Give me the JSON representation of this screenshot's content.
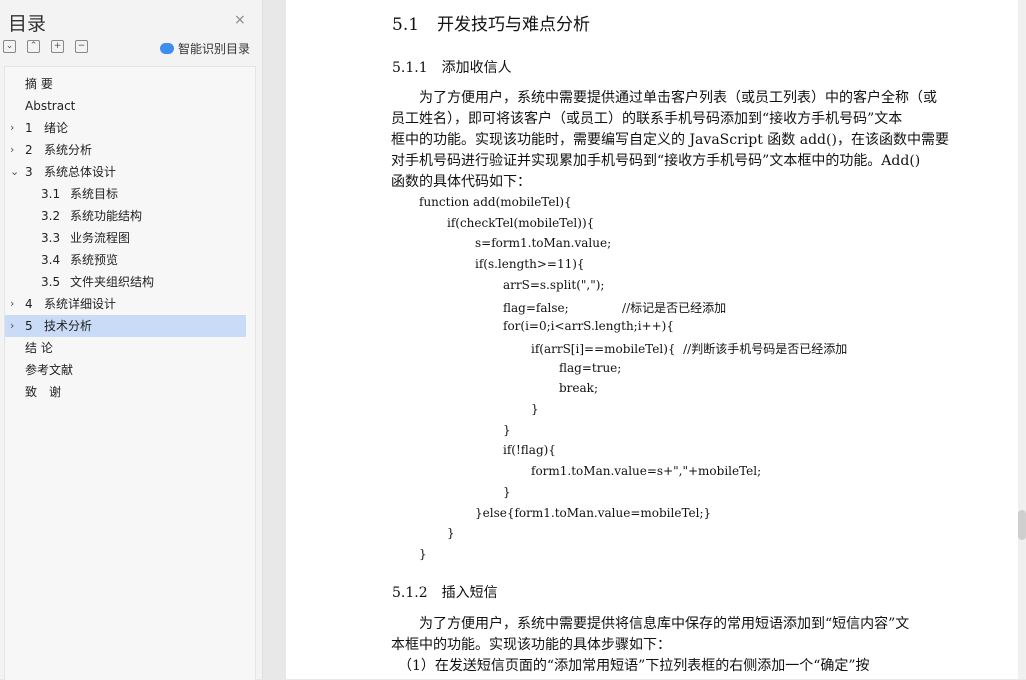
{
  "sidebar": {
    "title": "目录",
    "close_icon": "×",
    "tools": [
      "⌄",
      "⌃",
      "+",
      "−"
    ],
    "smart_label": "智能识别目录",
    "items": [
      {
        "num": "",
        "label": "摘 要",
        "chevron": ""
      },
      {
        "num": "",
        "label": "Abstract",
        "chevron": ""
      },
      {
        "num": "1",
        "label": "绪论",
        "chevron": "›"
      },
      {
        "num": "2",
        "label": "系统分析",
        "chevron": "›"
      },
      {
        "num": "3",
        "label": "系统总体设计",
        "chevron": "⌄"
      },
      {
        "num": "3.1",
        "label": "系统目标",
        "chevron": ""
      },
      {
        "num": "3.2",
        "label": "系统功能结构",
        "chevron": ""
      },
      {
        "num": "3.3",
        "label": "业务流程图",
        "chevron": ""
      },
      {
        "num": "3.4",
        "label": "系统预览",
        "chevron": ""
      },
      {
        "num": "3.5",
        "label": "文件夹组织结构",
        "chevron": ""
      },
      {
        "num": "4",
        "label": "系统详细设计",
        "chevron": "›"
      },
      {
        "num": "5",
        "label": "技术分析",
        "chevron": "›"
      },
      {
        "num": "",
        "label": "结 论",
        "chevron": ""
      },
      {
        "num": "",
        "label": "参考文献",
        "chevron": ""
      },
      {
        "num": "",
        "label": "致　谢",
        "chevron": ""
      }
    ]
  },
  "doc": {
    "h1": {
      "num": "5.1",
      "text": "开发技巧与难点分析"
    },
    "s1": {
      "num": "5.1.1",
      "text": "添加收信人"
    },
    "p1": [
      "　　为了方便用户，系统中需要提供通过单击客户列表（或员工列表）中的客户全称（或",
      "员工姓名），即可将该客户（或员工）的联系手机号码添加到“接收方手机号码”文本",
      "框中的功能。实现该功能时，需要编写自定义的 JavaScript 函数 add()，在该函数中需要",
      "对手机号码进行验证并实现累加手机号码到“接收方手机号码”文本框中的功能。Add()",
      "函数的具体代码如下："
    ],
    "code": [
      "function add(mobileTel){",
      "if(checkTel(mobileTel)){",
      "s=form1.toMan.value;",
      "if(s.length>=11){",
      "arrS=s.split(\",\");",
      "flag=false;              //标记是否已经添加",
      "for(i=0;i<arrS.length;i++){",
      "if(arrS[i]==mobileTel){  //判断该手机号码是否已经添加",
      "flag=true;",
      "break;",
      "}",
      "}",
      "if(!flag){",
      "form1.toMan.value=s+\",\"+mobileTel;",
      "}",
      "}else{form1.toMan.value=mobileTel;}",
      "}",
      "}"
    ],
    "s2": {
      "num": "5.1.2",
      "text": "插入短信"
    },
    "p2": [
      "　　为了方便用户，系统中需要提供将信息库中保存的常用短语添加到“短信内容”文",
      "本框中的功能。实现该功能的具体步骤如下：",
      "　（1）在发送短信页面的“添加常用短语”下拉列表框的右侧添加一个“确定”按"
    ]
  },
  "colors": {
    "sidebar_bg": "#f3f3f3",
    "selected": "#c9dbf6",
    "accent": "#3e8ef0"
  }
}
